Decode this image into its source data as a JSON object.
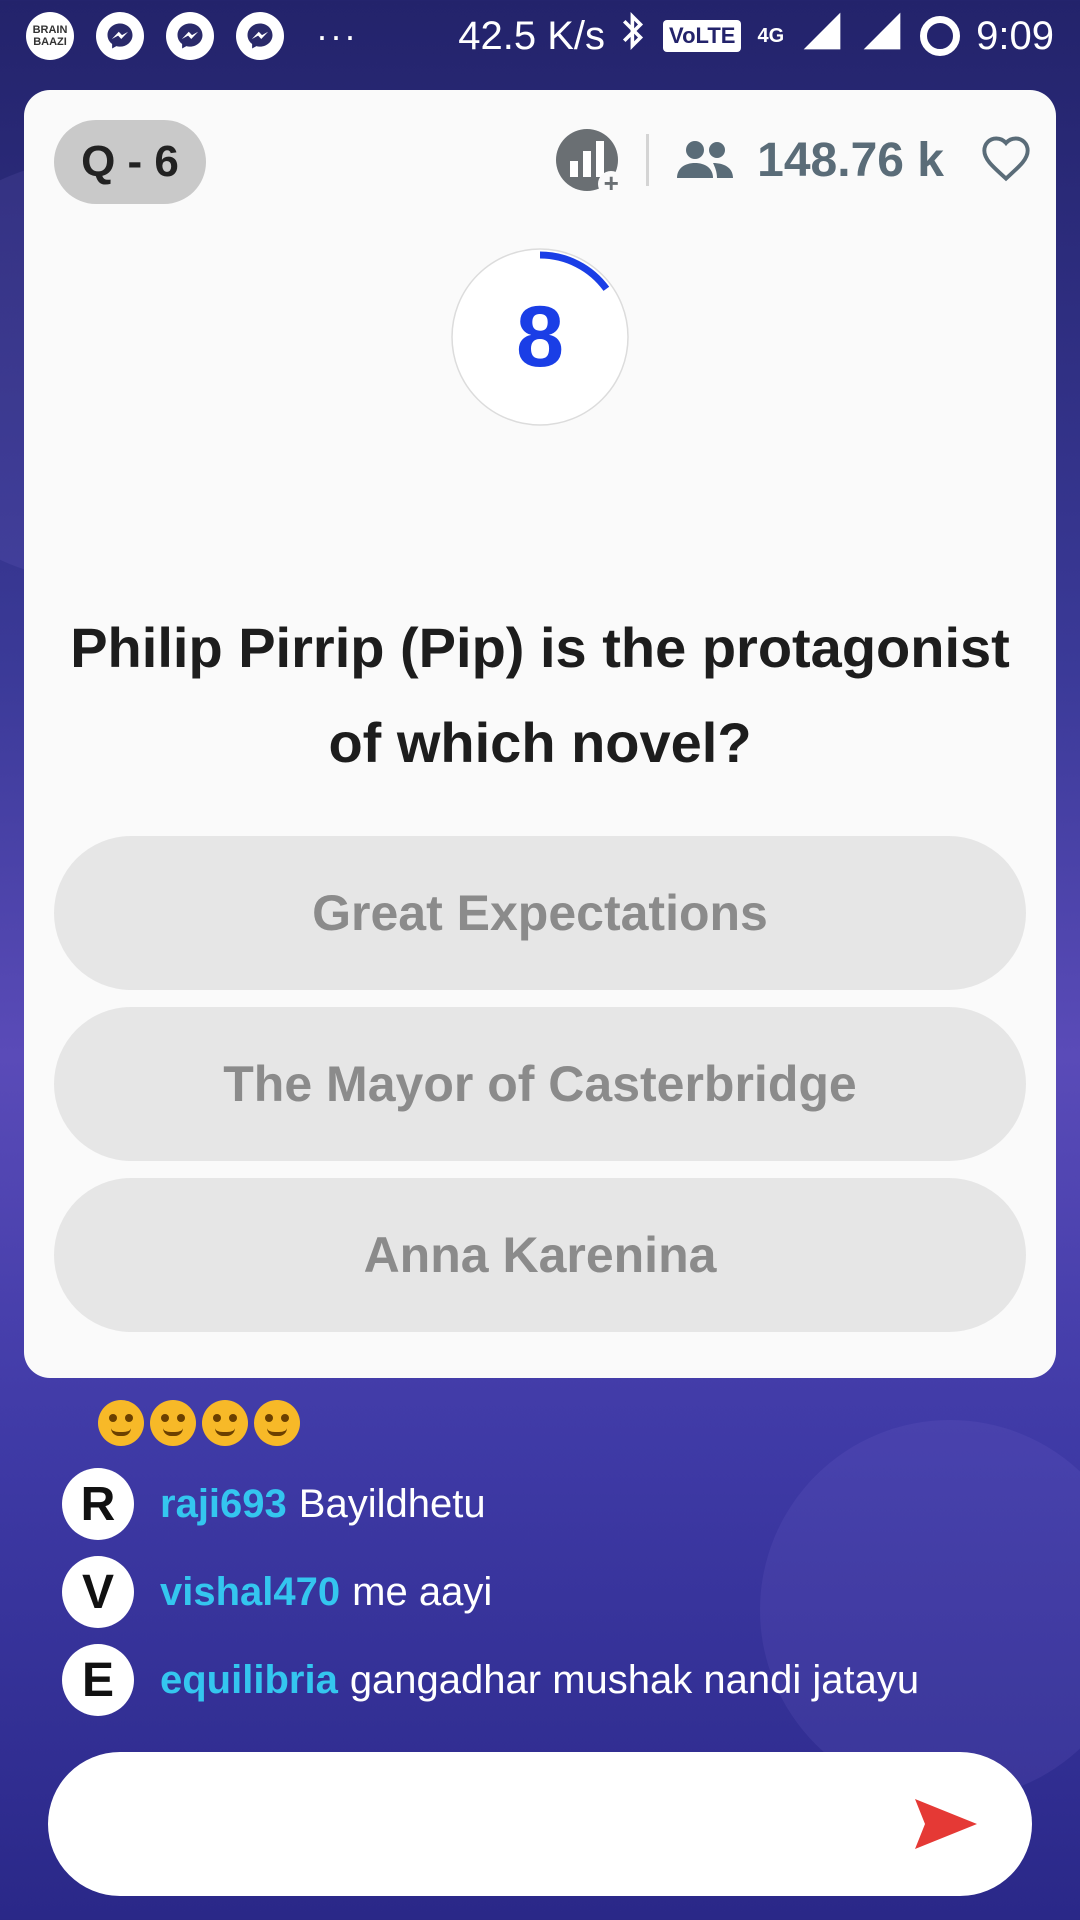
{
  "status_bar": {
    "app_icon_text": "BRAIN BAAZI",
    "dots": "···",
    "speed": "42.5 K/s",
    "volte": "VoLTE",
    "network": "4G",
    "time": "9:09"
  },
  "quiz": {
    "question_badge": "Q - 6",
    "viewers": "148.76 k",
    "timer": "8",
    "timer_progress": 0.15,
    "question": "Philip Pirrip (Pip) is the protagonist of which novel?",
    "options": [
      {
        "label": "Great Expectations"
      },
      {
        "label": "The Mayor of Casterbridge"
      },
      {
        "label": "Anna Karenina"
      }
    ]
  },
  "chat": {
    "messages": [
      {
        "avatar": "R",
        "user": "raji693",
        "text": "Bayildhetu"
      },
      {
        "avatar": "V",
        "user": "vishal470",
        "text": "me aayi"
      },
      {
        "avatar": "E",
        "user": "equilibria",
        "text": "gangadhar mushak nandi jatayu"
      }
    ],
    "input_placeholder": ""
  },
  "colors": {
    "accent_blue": "#1a3ee6",
    "username": "#34c6ef",
    "send": "#e53935"
  },
  "icons": [
    "messenger-icon",
    "bluetooth-icon",
    "signal-icon",
    "leaderboard-icon",
    "people-icon",
    "heart-icon",
    "send-icon"
  ]
}
